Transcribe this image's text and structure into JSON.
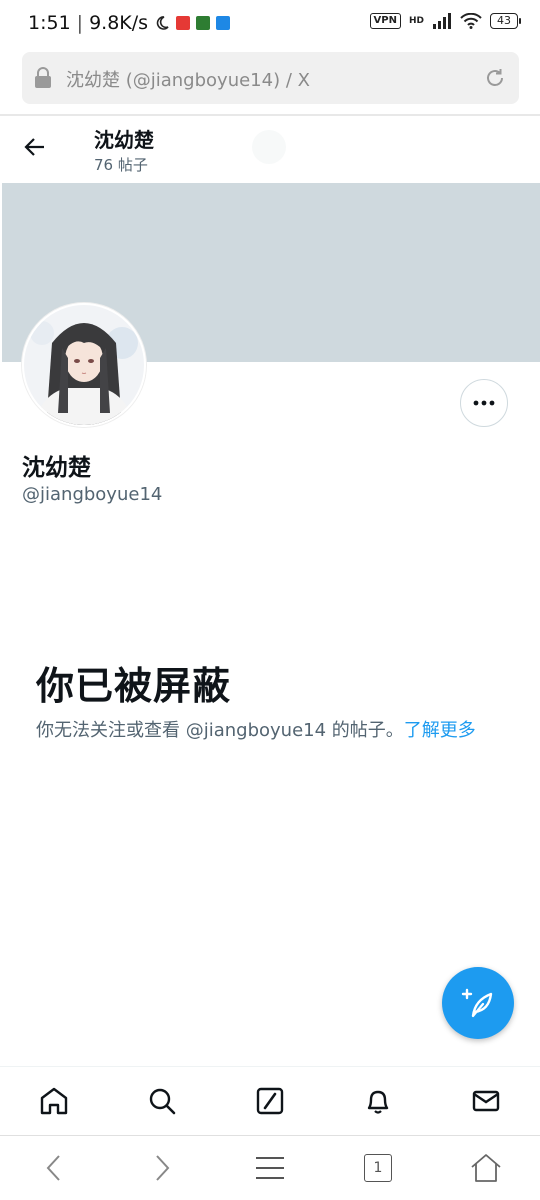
{
  "status_bar": {
    "time": "1:51",
    "network_speed": "9.8K/s",
    "vpn": "VPN",
    "network_type": "HD",
    "battery": "43"
  },
  "url_bar": {
    "text": "沈幼楚 (@jiangboyue14) / X"
  },
  "header": {
    "name": "沈幼楚",
    "post_count": "76 帖子"
  },
  "profile": {
    "name": "沈幼楚",
    "handle": "@jiangboyue14"
  },
  "blocked": {
    "title": "你已被屏蔽",
    "message": "你无法关注或查看 @jiangboyue14 的帖子。",
    "learn_more": "了解更多"
  },
  "browser_nav": {
    "tab_count": "1"
  },
  "colors": {
    "accent": "#1d9bf0",
    "banner": "#cfd9de",
    "secondary_text": "#536471"
  }
}
